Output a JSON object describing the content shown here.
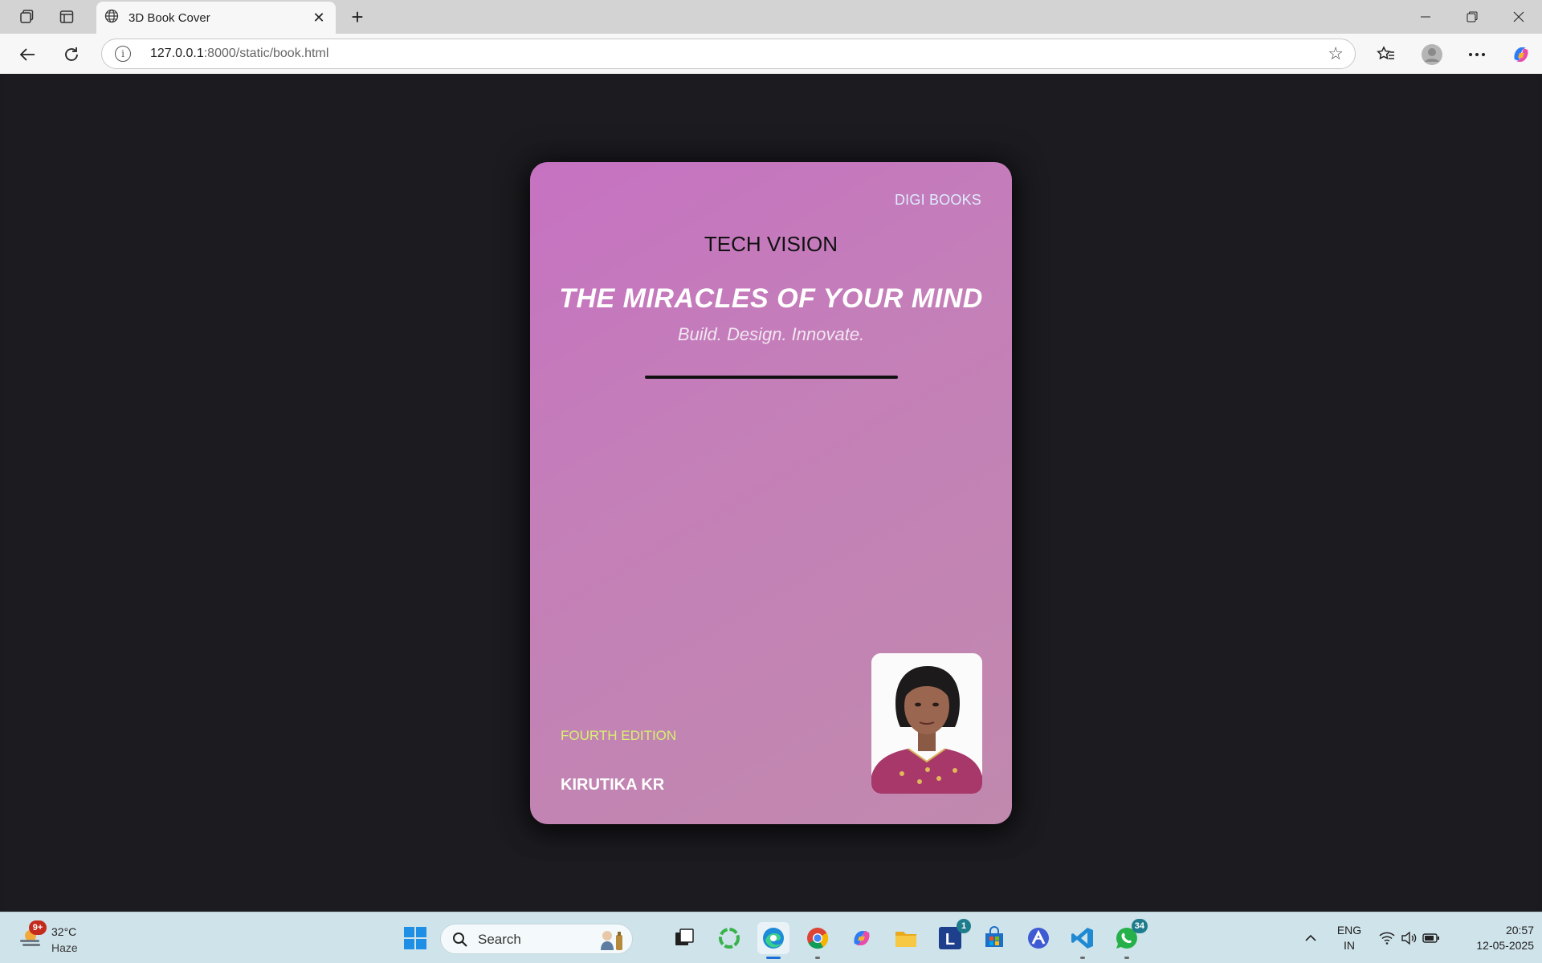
{
  "browser": {
    "tab_title": "3D Book Cover",
    "url_host": "127.0.0.1",
    "url_rest": ":8000/static/book.html"
  },
  "book": {
    "publisher": "DIGI BOOKS",
    "series": "TECH VISION",
    "title": "THE MIRACLES OF YOUR MIND",
    "tagline": "Build. Design. Innovate.",
    "edition": "FOURTH EDITION",
    "author": "KIRUTIKA KR",
    "colors": {
      "cover_start": "#c672c2",
      "cover_end": "#c189ae",
      "edition_text": "#d8f070",
      "publisher_text": "#ddeeff"
    }
  },
  "taskbar": {
    "weather": {
      "badge": "9+",
      "temp": "32°C",
      "condition": "Haze"
    },
    "search_label": "Search",
    "apps": [
      {
        "name": "start-icon"
      },
      {
        "name": "task-view-icon"
      },
      {
        "name": "copilot-loop-icon"
      },
      {
        "name": "edge-icon"
      },
      {
        "name": "chrome-icon"
      },
      {
        "name": "copilot-icon"
      },
      {
        "name": "file-explorer-icon"
      },
      {
        "name": "l-app-icon",
        "badge": "1"
      },
      {
        "name": "microsoft-store-icon"
      },
      {
        "name": "arc-icon"
      },
      {
        "name": "vscode-icon"
      },
      {
        "name": "whatsapp-icon",
        "badge": "34"
      }
    ],
    "lang_line1": "ENG",
    "lang_line2": "IN",
    "time": "20:57",
    "date": "12-05-2025"
  }
}
